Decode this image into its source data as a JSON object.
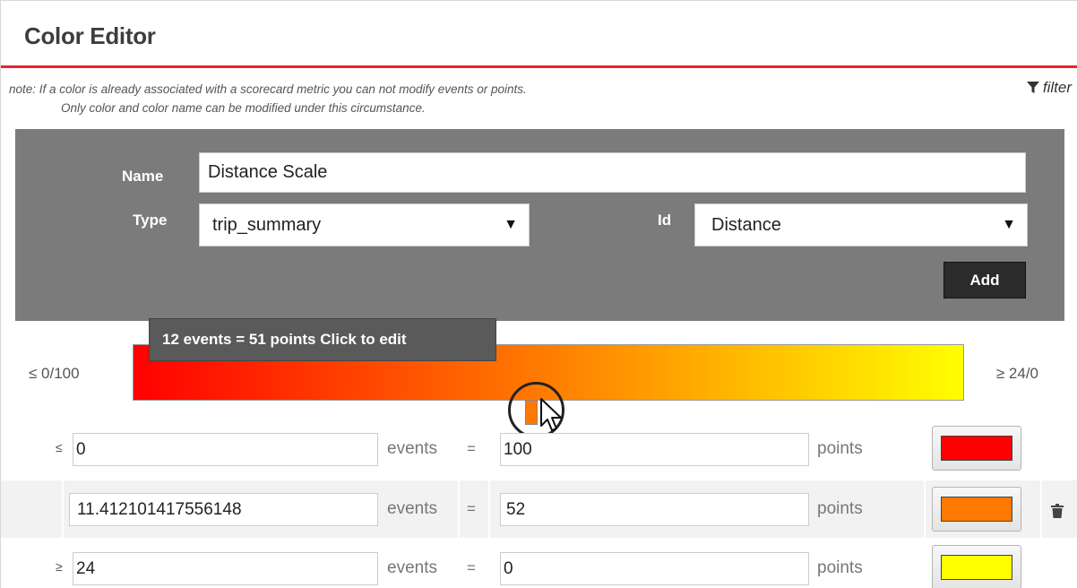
{
  "header": {
    "title": "Color Editor"
  },
  "note": {
    "line1": "note:  If a color is already associated with a scorecard metric you can not modify events or points.",
    "line2": "Only color and color name can be modified under this circumstance."
  },
  "filter": {
    "label": "filter",
    "icon": "filter-icon"
  },
  "form": {
    "name_label": "Name",
    "name_value": "Distance Scale",
    "type_label": "Type",
    "type_value": "trip_summary",
    "id_label": "Id",
    "id_value": "Distance",
    "add_label": "Add"
  },
  "scale": {
    "left_label": "≤ 0/100",
    "right_label": "≥ 24/0",
    "tooltip": "12 events = 51 points Click to edit",
    "colors": {
      "start": "#ff0000",
      "mid": "#ff7800",
      "end": "#ffff00"
    },
    "handle_position_fraction": 0.48
  },
  "rows": [
    {
      "comparator": "≤",
      "events": "0",
      "events_label": "events",
      "equals": "=",
      "points": "100",
      "points_label": "points",
      "color": "#ff0000"
    },
    {
      "comparator": "",
      "events": "11.412101417556148",
      "events_label": "events",
      "equals": "=",
      "points": "52",
      "points_label": "points",
      "color": "#ff7800",
      "deletable": true
    },
    {
      "comparator": "≥",
      "events": "24",
      "events_label": "events",
      "equals": "=",
      "points": "0",
      "points_label": "points",
      "color": "#ffff00"
    }
  ],
  "colors": {
    "accent": "#e8242c",
    "panel": "#7b7b7b"
  }
}
